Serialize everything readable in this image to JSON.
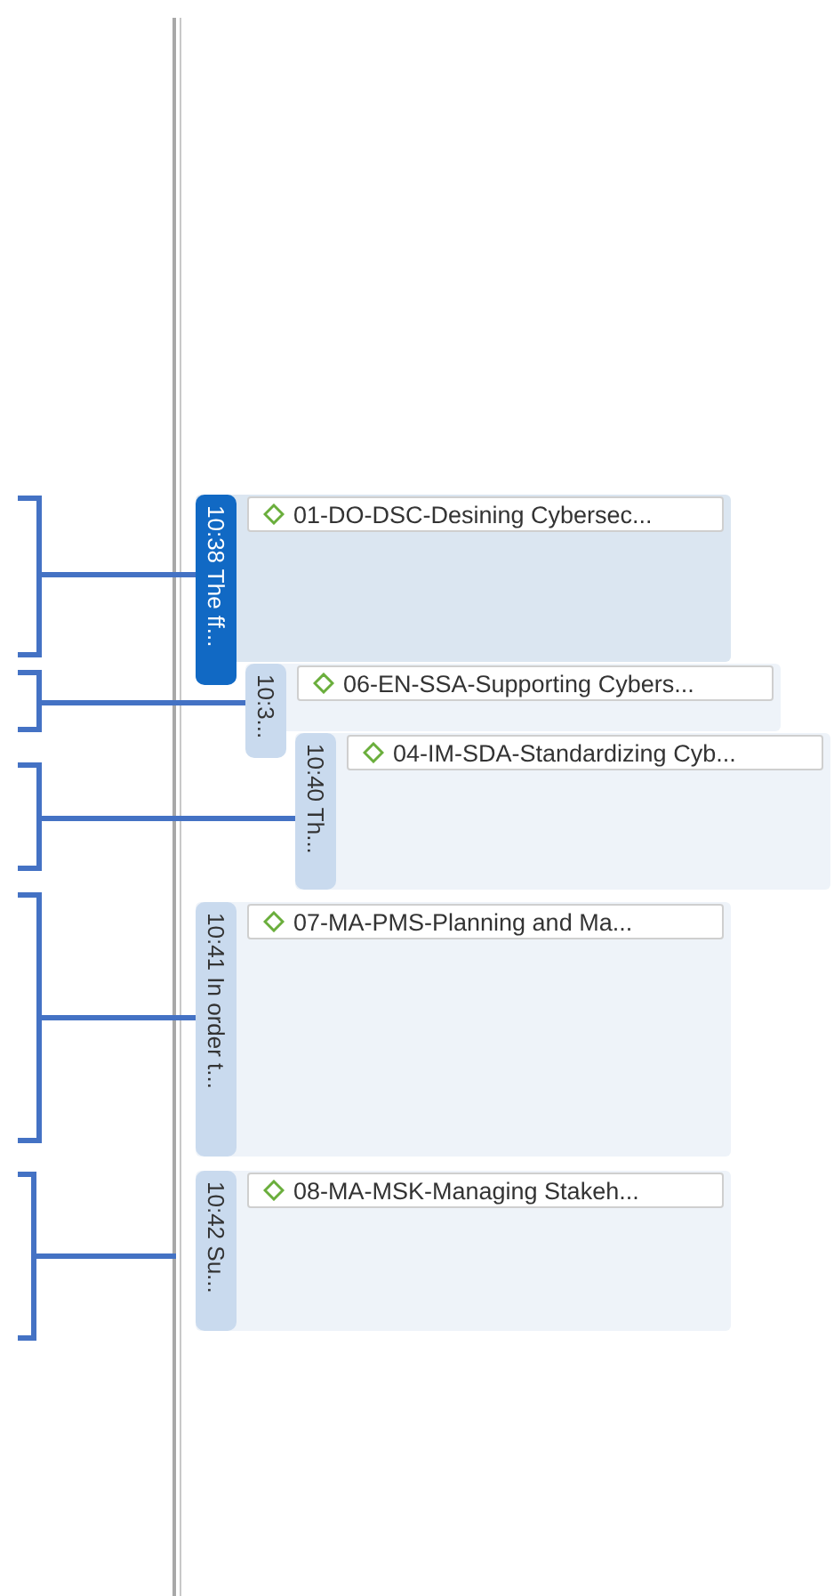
{
  "timeline": {
    "items": [
      {
        "time_label": "10:38 The ff...",
        "selected": true,
        "task": "01-DO-DSC-Desining Cybersec...",
        "children": [
          {
            "time_label": "10:3...",
            "selected": false,
            "task": "06-EN-SSA-Supporting Cybers...",
            "children": [
              {
                "time_label": "10:40 Th...",
                "selected": false,
                "task": "04-IM-SDA-Standardizing Cyb..."
              }
            ]
          }
        ]
      },
      {
        "time_label": "10:41 In order t...",
        "selected": false,
        "task": "07-MA-PMS-Planning and Ma..."
      },
      {
        "time_label": "10:42 Su...",
        "selected": false,
        "task": "08-MA-MSK-Managing Stakeh..."
      }
    ]
  }
}
